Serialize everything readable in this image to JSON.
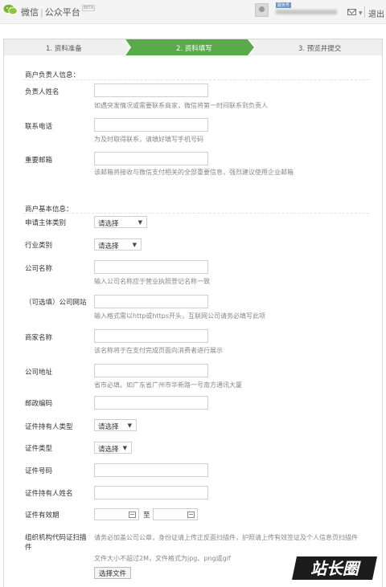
{
  "header": {
    "brand": "微信",
    "separator": "|",
    "product": "公众平台",
    "badge": "服务号",
    "logout": "退出"
  },
  "steps": [
    {
      "label": "1. 资料准备",
      "active": false
    },
    {
      "label": "2. 资料填写",
      "active": true
    },
    {
      "label": "3. 预览并提交",
      "active": false
    }
  ],
  "colors": {
    "step_active": "#5aa94b",
    "step_idle": "#efefef"
  },
  "section_person": {
    "title": "商户负责人信息：",
    "fields": {
      "name": {
        "label": "负责人姓名",
        "hint": "如遇突发情况或需要联系商家，微信将第一时间联系到负责人"
      },
      "phone": {
        "label": "联系电话",
        "hint": "为及时取得联系，请填好填写手机号码"
      },
      "email": {
        "label": "重要邮箱",
        "hint": "该邮箱将接收与微信支付相关的全部重要信息，强烈建议使用企业邮箱"
      }
    }
  },
  "section_basic": {
    "title": "商户基本信息：",
    "subject_type": {
      "label": "申请主体类别",
      "value": "请选择"
    },
    "industry": {
      "label": "行业类别",
      "value": "请选择"
    },
    "company_name": {
      "label": "公司名称",
      "hint": "输入公司名称应于营业执照登记名称一致"
    },
    "website": {
      "label": "（可选填）公司网站",
      "hint": "输入格式需以http或https开头，互联网公司请务必填写此项"
    },
    "merchant_name": {
      "label": "商家名称",
      "hint": "该名称将于在支付完成页面向消费者进行展示"
    },
    "address": {
      "label": "公司地址",
      "hint": "省市必填。如广东省广州市华新路一号南方通讯大厦"
    },
    "postcode": {
      "label": "邮政编码"
    },
    "holder_type": {
      "label": "证件持有人类型",
      "value": "请选择"
    },
    "id_type": {
      "label": "证件类型",
      "value": "请选择"
    },
    "id_number": {
      "label": "证件号码"
    },
    "holder_name": {
      "label": "证件持有人姓名"
    },
    "validity": {
      "label": "证件有效期",
      "to": "至"
    },
    "org_scan": {
      "label": "组织机构代码证扫描件",
      "hint": "请务必加盖公司公章，身份证请上传正反面扫描件，护照请上传有效签证及个人信息页扫描件",
      "size_hint": "文件大小不超过2M，文件格式为jpg、png或gif",
      "button": "选择文件"
    }
  },
  "watermark": {
    "text": "站长圈"
  }
}
